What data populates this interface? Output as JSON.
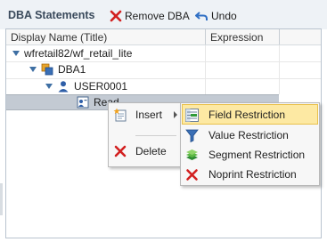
{
  "toolbar": {
    "title": "DBA Statements",
    "remove_dba_label": "Remove DBA",
    "undo_label": "Undo"
  },
  "grid": {
    "columns": [
      "Display Name (Title)",
      "Expression"
    ],
    "rows": [
      {
        "label": "wfretail82/wf_retail_lite",
        "icon": "file-node-icon",
        "expanded": true
      },
      {
        "label": "DBA1",
        "icon": "dba-group-icon",
        "expanded": true
      },
      {
        "label": "USER0001",
        "icon": "user-icon",
        "expanded": true
      },
      {
        "label": "Read",
        "icon": "read-permission-icon",
        "selected": true
      }
    ]
  },
  "context_menu": {
    "items": [
      {
        "label": "Insert",
        "icon": "insert-icon",
        "has_submenu": true
      },
      {
        "label": "Delete",
        "icon": "delete-icon"
      }
    ]
  },
  "submenu": {
    "items": [
      {
        "label": "Field Restriction",
        "icon": "field-restriction-icon",
        "highlighted": true
      },
      {
        "label": "Value Restriction",
        "icon": "filter-funnel-icon"
      },
      {
        "label": "Segment Restriction",
        "icon": "segment-stack-icon"
      },
      {
        "label": "Noprint Restriction",
        "icon": "red-x-icon"
      }
    ]
  },
  "colors": {
    "toolbar_bg": "#eef2f6",
    "title_text": "#3a4a5c",
    "tree_triangle": "#3e6fa3",
    "selected_row": "#c3cad3",
    "menu_highlight": "#fde9a3",
    "delete_red": "#d22020"
  }
}
